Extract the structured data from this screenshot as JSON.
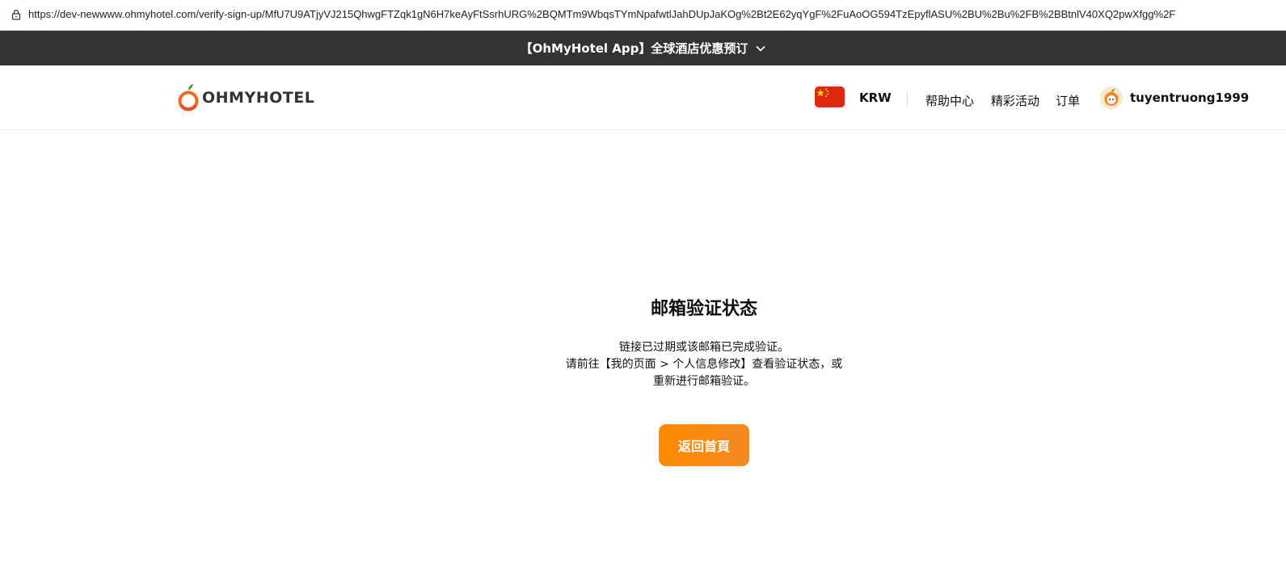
{
  "browser": {
    "url": "https://dev-newwww.ohmyhotel.com/verify-sign-up/MfU7U9ATjyVJ215QhwgFTZqk1gN6H7keAyFtSsrhURG%2BQMTm9WbqsTYmNpafwtlJahDUpJaKOg%2Bt2E62yqYgF%2FuAoOG594TzEpyflASU%2BU%2Bu%2FB%2BBtnlV40XQ2pwXfgg%2F"
  },
  "promo": {
    "text": "【OhMyHotel App】全球酒店优惠预订",
    "icon": "chevron-down-icon"
  },
  "header": {
    "logo_text": "OHMYHOTEL",
    "flag_icon": "china-flag-icon",
    "currency": "KRW",
    "nav": {
      "help": "帮助中心",
      "events": "精彩活动",
      "orders": "订单"
    },
    "username": "tuyentruong1999"
  },
  "main": {
    "title": "邮箱验证状态",
    "message_lines": [
      "链接已过期或该邮箱已完成验证。",
      "请前往【我的页面 > 个人信息修改】查看验证状态，或",
      "重新进行邮箱验证。"
    ],
    "home_button": "返回首頁"
  },
  "colors": {
    "promo_bg": "#333333",
    "accent": "#f58a24",
    "flag_red": "#de2910",
    "flag_star": "#ffde00"
  }
}
